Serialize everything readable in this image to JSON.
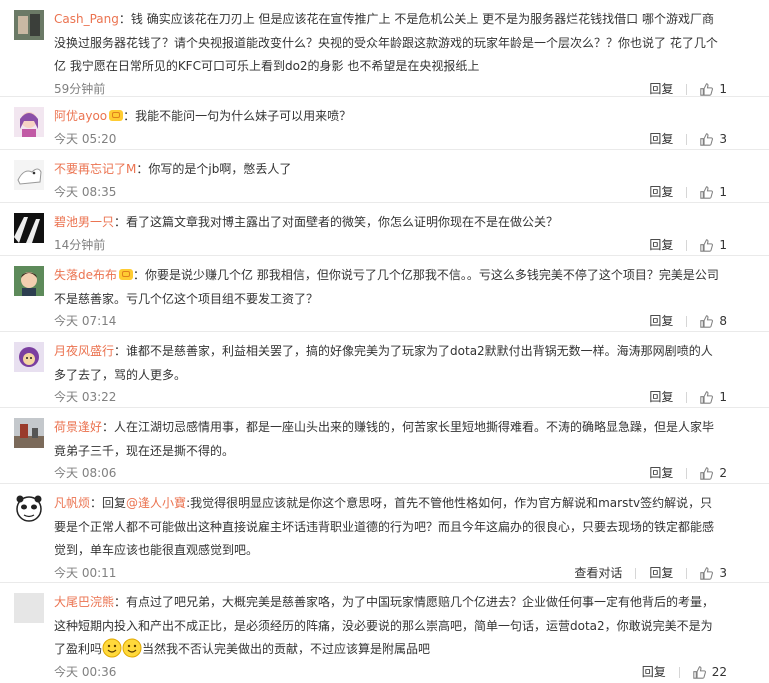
{
  "labels": {
    "reply": "回复",
    "view_dialog": "查看对话",
    "colon": "："
  },
  "comments": [
    {
      "user": "Cash_Pang",
      "vip": false,
      "text": "钱 确实应该花在刀刃上 但是应该花在宣传推广上 不是危机公关上 更不是为服务器烂花钱找借口 哪个游戏厂商没换过服务器花钱了？请个央视报道能改变什么？央视的受众年龄跟这款游戏的玩家年龄是一个层次么？？你也说了 花了几个亿 我宁愿在日常所见的KFC可口可乐上看到do2的身影 也不希望是在央视报纸上",
      "time": "59分钟前",
      "likes": "1"
    },
    {
      "user": "阿优ayoo",
      "vip": true,
      "text": "我能不能问一句为什么妹子可以用来喷？",
      "time": "今天 05:20",
      "likes": "3"
    },
    {
      "user": "不要再忘记了M",
      "vip": false,
      "text": "你写的是个jb啊，憋丢人了",
      "time": "今天 08:35",
      "likes": "1"
    },
    {
      "user": "碧池男一只",
      "vip": false,
      "text": "看了这篇文章我对博主露出了对面壁者的微笑，你怎么证明你现在不是在做公关？",
      "time": "14分钟前",
      "likes": "1"
    },
    {
      "user": "失落de布布",
      "vip": true,
      "text": "你要是说少赚几个亿 那我相信，但你说亏了几个亿那我不信。。亏这么多钱完美不停了这个项目？完美是公司不是慈善家。亏几个亿这个项目组不要发工资了？",
      "time": "今天 07:14",
      "likes": "8"
    },
    {
      "user": "月夜风盛行",
      "vip": false,
      "text": "谁都不是慈善家，利益相关罢了，搞的好像完美为了玩家为了dota2默默付出背锅无数一样。海涛那网剧喷的人多了去了，骂的人更多。",
      "time": "今天 03:22",
      "likes": "1"
    },
    {
      "user": "荷景逢好",
      "vip": false,
      "text": "人在江湖切忌感情用事，都是一座山头出来的赚钱的，何苦家长里短地撕得难看。不涛的确略显急躁，但是人家毕竟弟子三千，现在还是撕不得的。",
      "time": "今天 08:06",
      "likes": "2"
    },
    {
      "user": "凡帆烦",
      "vip": false,
      "text_prefix": "回复",
      "mention": "@逢人小寶",
      "text": ":我觉得很明显应该就是你这个意思呀，首先不管他性格如何，作为官方解说和marstv签约解说，只要是个正常人都不可能做出这种直接说雇主坏话违背职业道德的行为吧？而且今年这扁办的很良心，只要去现场的铁定都能感觉到，单车应该也能很直观感觉到吧。",
      "time": "今天 00:11",
      "likes": "3",
      "view_dialog": true
    },
    {
      "user": "大尾巴浣熊",
      "vip": false,
      "text": "有点过了吧兄弟，大概完美是慈善家咯，为了中国玩家情愿赔几个亿进去？企业做任何事一定有他背后的考量，这种短期内投入和产出不成正比，是必须经历的阵痛，没必要说的那么崇高吧，简单一句话，运营dota2，你敢说完美不是为了盈利吗",
      "text_suffix": "当然我不否认完美做出的贡献，不过应该算是附属品吧",
      "emoji_count": 2,
      "time": "今天 00:36",
      "likes": "22"
    }
  ],
  "colors": {
    "username": "#eb7350",
    "time": "#808080",
    "text": "#333333",
    "divider": "#eaeaea"
  },
  "icons": [
    "avatar",
    "vip-badge-icon",
    "thumbs-up-icon",
    "smile-emoji-icon"
  ]
}
